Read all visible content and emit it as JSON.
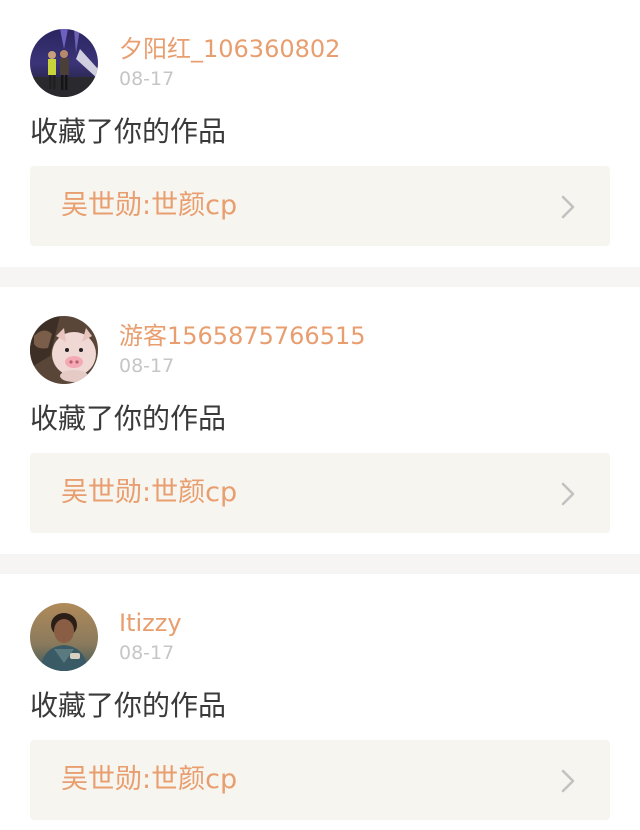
{
  "notifications": [
    {
      "username": "夕阳红_106360802",
      "date": "08-17",
      "action": "收藏了你的作品",
      "work_title": "吴世勋:世颜cp"
    },
    {
      "username": "游客1565875766515",
      "date": "08-17",
      "action": "收藏了你的作品",
      "work_title": "吴世勋:世颜cp"
    },
    {
      "username": "Itizzy",
      "date": "08-17",
      "action": "收藏了你的作品",
      "work_title": "吴世勋:世颜cp"
    }
  ],
  "colors": {
    "accent": "#e89e6f",
    "date_gray": "#c6c6c6",
    "body_text": "#3a3a3a",
    "work_bg": "#f6f5ef",
    "separator": "#f7f5f4"
  },
  "icons": {
    "avatar": "user-avatar",
    "work_arrow": "chevron-right-icon"
  }
}
